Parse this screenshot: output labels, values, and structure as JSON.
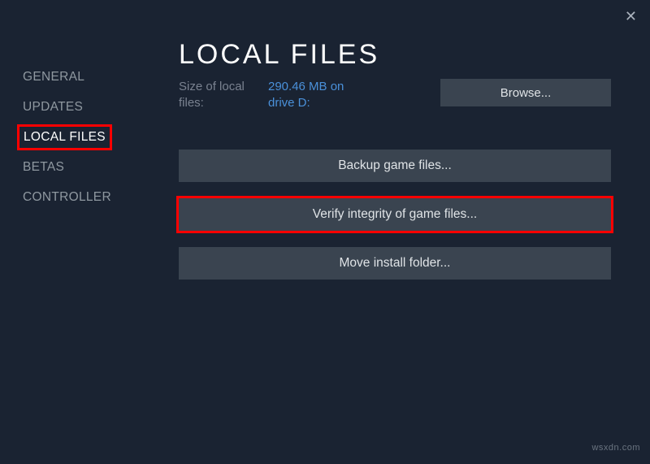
{
  "window": {
    "title": "LOCAL FILES"
  },
  "sidebar": {
    "items": [
      {
        "label": "GENERAL"
      },
      {
        "label": "UPDATES"
      },
      {
        "label": "LOCAL FILES"
      },
      {
        "label": "BETAS"
      },
      {
        "label": "CONTROLLER"
      }
    ]
  },
  "info": {
    "size_label_line1": "Size of local",
    "size_label_line2": "files:",
    "size_value_line1": "290.46 MB on",
    "size_value_line2": "drive D:",
    "browse_label": "Browse..."
  },
  "actions": {
    "backup_label": "Backup game files...",
    "verify_label": "Verify integrity of game files...",
    "move_label": "Move install folder..."
  },
  "watermark": "wsxdn.com"
}
